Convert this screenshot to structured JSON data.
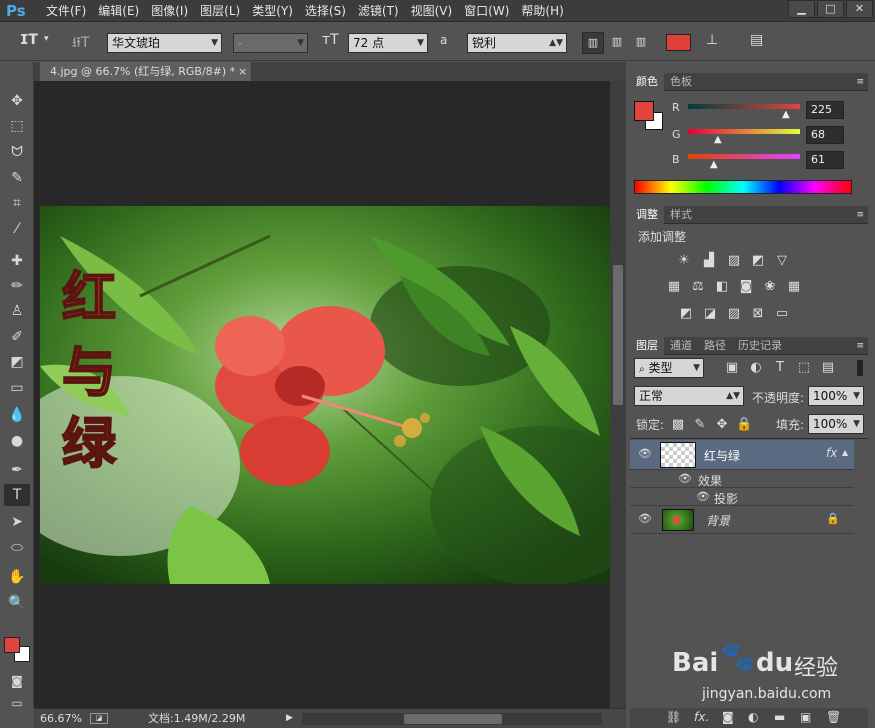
{
  "app": {
    "logo": "Ps"
  },
  "menu": [
    "文件(F)",
    "编辑(E)",
    "图像(I)",
    "图层(L)",
    "类型(Y)",
    "选择(S)",
    "滤镜(T)",
    "视图(V)",
    "窗口(W)",
    "帮助(H)"
  ],
  "window_controls": [
    "▁",
    "□",
    "✕"
  ],
  "options": {
    "font_family": "华文琥珀",
    "font_style": "-",
    "font_size": "72 点",
    "aa_label": "a",
    "antialias": "锐利",
    "text_color": "#e0403a"
  },
  "document": {
    "tab": "4.jpg @ 66.7% (红与绿, RGB/8#) *",
    "close": "×",
    "overlay_text": [
      "红",
      "与",
      "绿"
    ]
  },
  "status": {
    "zoom": "66.67%",
    "doc": "文档:1.49M/2.29M"
  },
  "color_panel": {
    "tabs": [
      "颜色",
      "色板"
    ],
    "r_label": "R",
    "g_label": "G",
    "b_label": "B",
    "r": "225",
    "g": "68",
    "b": "61",
    "fg": "#e1443d",
    "bg": "#ffffff"
  },
  "adjust_panel": {
    "tabs": [
      "调整",
      "样式"
    ],
    "title": "添加调整"
  },
  "layers_panel": {
    "tabs": [
      "图层",
      "通道",
      "路径",
      "历史记录"
    ],
    "filter": "类型",
    "blend_mode": "正常",
    "opacity_label": "不透明度:",
    "opacity": "100%",
    "lock_label": "锁定:",
    "fill_label": "填充:",
    "fill": "100%",
    "layers": [
      {
        "name": "红与绿",
        "fx": "fx"
      },
      {
        "name": "效果"
      },
      {
        "name": "投影"
      },
      {
        "name": "背景"
      }
    ]
  },
  "watermark": {
    "brand": "Bai",
    "brand2": "du",
    "site": "经验",
    "url": "jingyan.baidu.com"
  }
}
